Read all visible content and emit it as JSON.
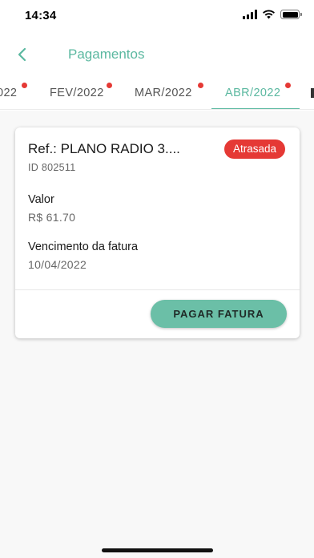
{
  "status_bar": {
    "time": "14:34"
  },
  "nav": {
    "title": "Pagamentos",
    "back_icon": "chevron-left-icon"
  },
  "tabs": [
    {
      "label": "022",
      "has_alert": true,
      "active": false
    },
    {
      "label": "FEV/2022",
      "has_alert": true,
      "active": false
    },
    {
      "label": "MAR/2022",
      "has_alert": true,
      "active": false
    },
    {
      "label": "ABR/2022",
      "has_alert": true,
      "active": true
    }
  ],
  "invoice": {
    "reference": "Ref.: PLANO RADIO 3....",
    "status": "Atrasada",
    "id": "ID 802511",
    "amount_label": "Valor",
    "amount": "R$ 61.70",
    "due_label": "Vencimento da fatura",
    "due_date": "10/04/2022",
    "pay_button": "PAGAR FATURA"
  },
  "colors": {
    "accent": "#5bb8a0",
    "button": "#6bbfa7",
    "alert": "#e53935",
    "background": "#f8f8f8"
  }
}
